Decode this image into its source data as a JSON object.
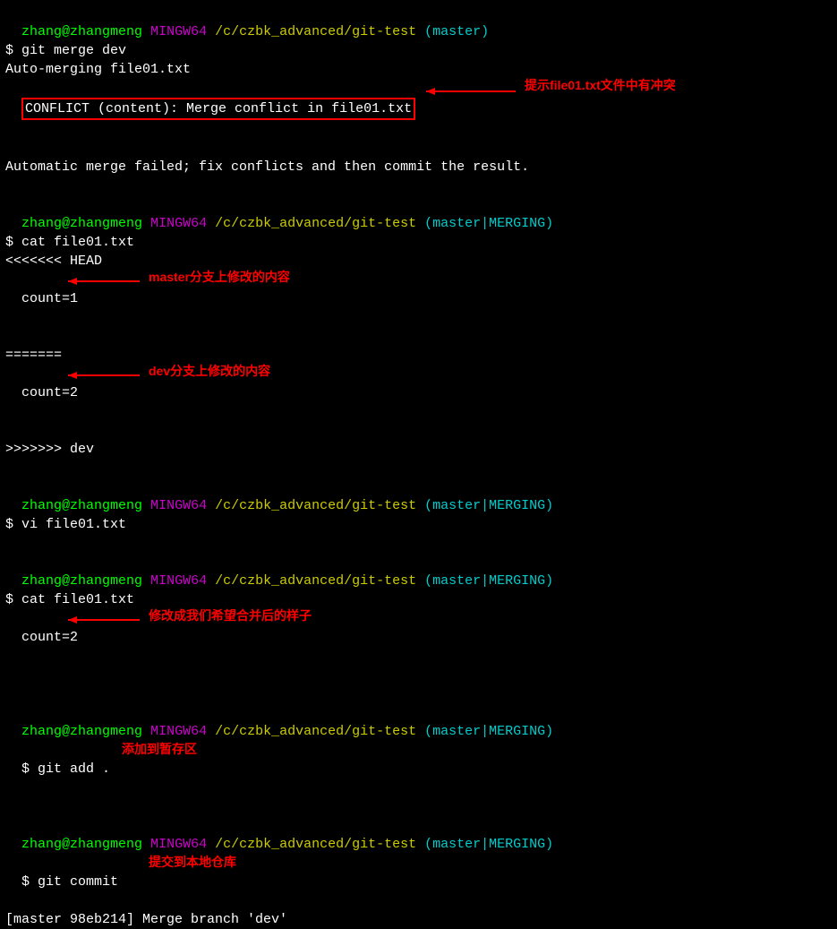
{
  "prompt1": {
    "user_host": "zhang@zhangmeng",
    "shell": "MINGW64",
    "path": "/c/czbk_advanced/git-test",
    "branch": "(master)"
  },
  "cmd1": "$ git merge dev",
  "out1": "Auto-merging file01.txt",
  "out2": "CONFLICT (content): Merge conflict in file01.txt",
  "out3": "Automatic merge failed; fix conflicts and then commit the result.",
  "prompt2": {
    "user_host": "zhang@zhangmeng",
    "shell": "MINGW64",
    "path": "/c/czbk_advanced/git-test",
    "branch": "(master|MERGING)"
  },
  "cmd2": "$ cat file01.txt",
  "file1": "<<<<<<< HEAD",
  "file2": "count=1",
  "file3": "=======",
  "file4": "count=2",
  "file5": ">>>>>>> dev",
  "cmd3": "$ vi file01.txt",
  "cmd4": "$ cat file01.txt",
  "file6": "count=2",
  "cmd5": "$ git add .",
  "cmd6": "$ git commit",
  "out4": "[master 98eb214] Merge branch 'dev'",
  "annotations": {
    "a1": "提示file01.txt文件中有冲突",
    "a2": "master分支上修改的内容",
    "a3": "dev分支上修改的内容",
    "a4": "修改成我们希望合并后的样子",
    "a5": "添加到暂存区",
    "a6": "提交到本地仓库"
  }
}
